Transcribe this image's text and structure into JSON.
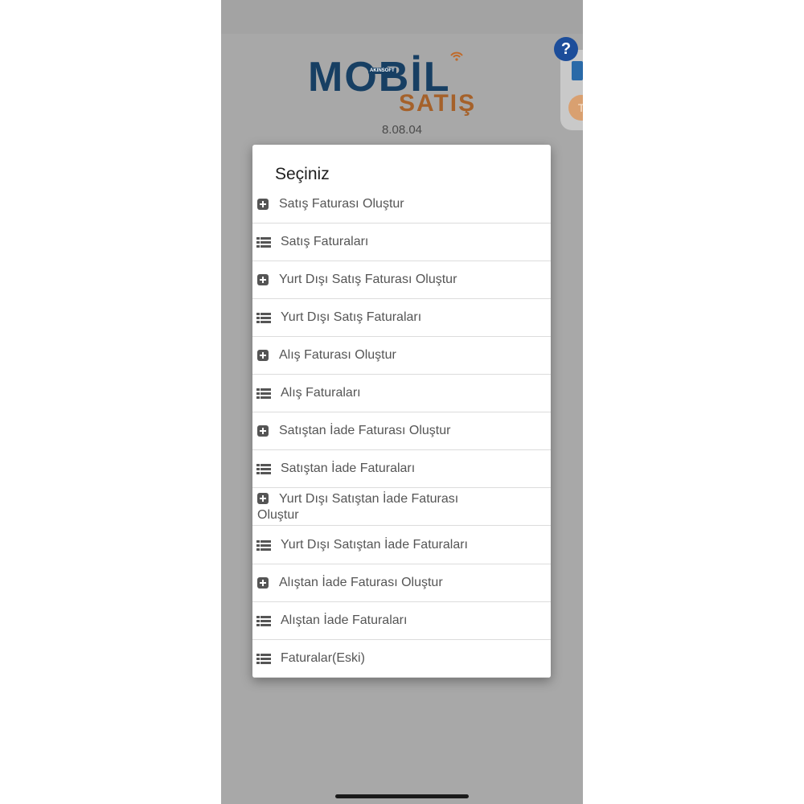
{
  "app": {
    "logo_main": "MOBİL",
    "logo_sub": "SATIŞ",
    "logo_badge": "AKINSOFT",
    "version": "8.08.04",
    "help_label": "?",
    "side_panel_letter": "T"
  },
  "dialog": {
    "title": "Seçiniz",
    "items": [
      {
        "label": "Satış Faturası Oluştur",
        "icon": "plus-square-icon"
      },
      {
        "label": "Satış Faturaları",
        "icon": "list-icon"
      },
      {
        "label": "Yurt Dışı Satış Faturası Oluştur",
        "icon": "plus-square-icon"
      },
      {
        "label": "Yurt Dışı Satış Faturaları",
        "icon": "list-icon"
      },
      {
        "label": "Alış Faturası Oluştur",
        "icon": "plus-square-icon"
      },
      {
        "label": "Alış Faturaları",
        "icon": "list-icon"
      },
      {
        "label": "Satıştan İade Faturası Oluştur",
        "icon": "plus-square-icon"
      },
      {
        "label": "Satıştan İade Faturaları",
        "icon": "list-icon"
      },
      {
        "label": "Yurt Dışı Satıştan İade Faturası Oluştur",
        "icon": "plus-square-icon"
      },
      {
        "label": "Yurt Dışı Satıştan İade Faturaları",
        "icon": "list-icon"
      },
      {
        "label": "Alıştan İade Faturası Oluştur",
        "icon": "plus-square-icon"
      },
      {
        "label": "Alıştan İade Faturaları",
        "icon": "list-icon"
      },
      {
        "label": "Faturalar(Eski)",
        "icon": "list-icon"
      }
    ]
  },
  "colors": {
    "overlay": "#a8a8a8",
    "logo_blue": "#173f63",
    "logo_orange": "#a5612a",
    "help_blue": "#1c4d9a",
    "item_text": "#555555"
  }
}
